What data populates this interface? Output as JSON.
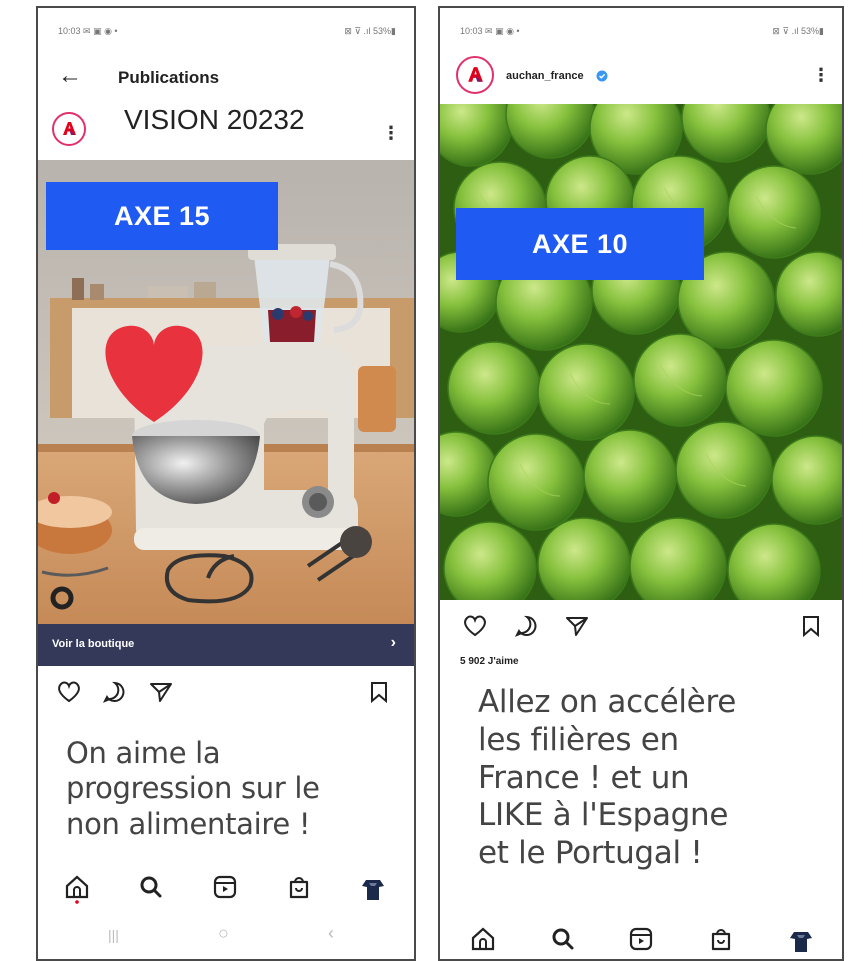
{
  "left_screen": {
    "status_left": "10:03 ✉ ▣ ◉ •",
    "status_right": "⊠ ⊽ .ıl 53%▮",
    "header_title": "Publications",
    "post_title": "VISION 20232",
    "badge": "AXE 15",
    "shop_label": "Voir la boutique",
    "shop_chevron": "›",
    "caption_lines": [
      "On aime la",
      "progression sur le",
      "non alimentaire !"
    ],
    "sys_nav": {
      "recent": "|||",
      "home": "○",
      "back": "‹"
    }
  },
  "right_screen": {
    "status_left": "10:03 ✉ ▣ ◉ •",
    "status_right": "⊠ ⊽ .ıl 53%▮",
    "account_name": "auchan_france",
    "badge": "AXE 10",
    "likes": "5 902 J'aime",
    "caption_lines": [
      "Allez on accélère",
      "les filières en",
      "France ! et un",
      "LIKE à l'Espagne",
      "et le Portugal !"
    ]
  },
  "colors": {
    "badge_blue": "#1f5bf3",
    "shop_bar": "#34395a",
    "heart_red": "#e8323e",
    "verified_blue": "#3897f0",
    "auchan_red": "#e2001a"
  },
  "icons": {
    "actions": [
      "heart-icon",
      "comment-icon",
      "share-icon",
      "bookmark-icon"
    ],
    "nav": [
      "home-icon",
      "search-icon",
      "reels-icon",
      "shop-icon",
      "profile-avatar"
    ]
  }
}
